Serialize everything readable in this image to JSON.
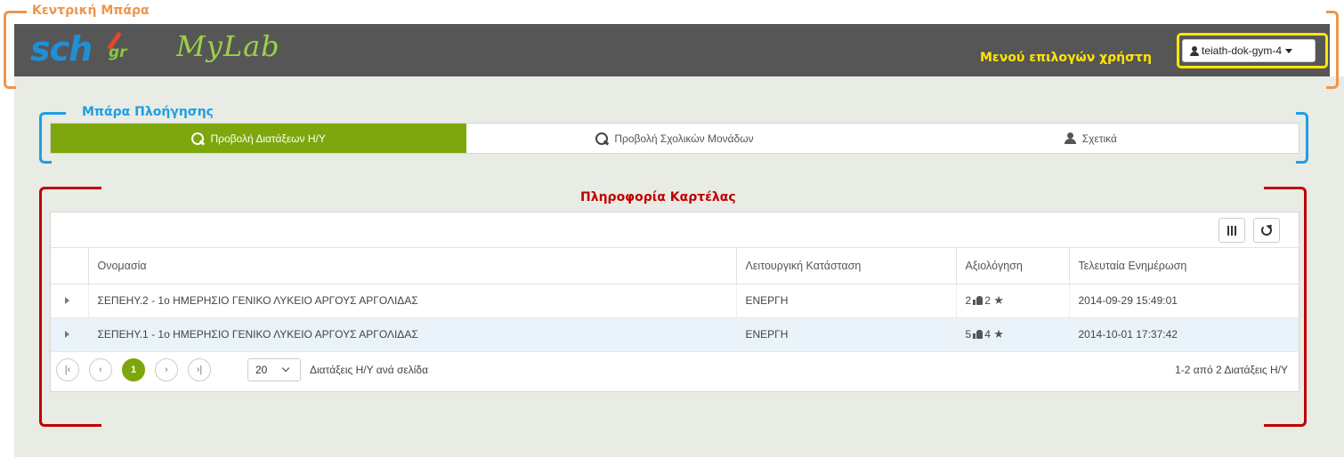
{
  "annotations": {
    "central_bar": "Κεντρική Μπάρα",
    "user_menu": "Μενού επιλογών χρήστη",
    "nav_bar": "Μπάρα Πλοήγησης",
    "tab_info": "Πληροφορία Καρτέλας"
  },
  "header": {
    "logo_sch": "sch",
    "logo_gr": "gr",
    "logo_mylab": "MyLab",
    "user_name": "teiath-dok-gym-4"
  },
  "nav": {
    "tabs": [
      {
        "label": "Προβολή Διατάξεων Η/Υ",
        "active": true,
        "icon": "search-icon"
      },
      {
        "label": "Προβολή Σχολικών Μονάδων",
        "active": false,
        "icon": "search-icon"
      },
      {
        "label": "Σχετικά",
        "active": false,
        "icon": "user-icon"
      }
    ]
  },
  "grid": {
    "columns": [
      "Ονομασία",
      "Λειτουργική Κατάσταση",
      "Αξιολόγηση",
      "Τελευταία Ενημέρωση"
    ],
    "rows": [
      {
        "name": "ΣΕΠΕΗΥ.2 - 1ο ΗΜΕΡΗΣΙΟ ΓΕΝΙΚΟ ΛΥΚΕΙΟ ΑΡΓΟΥΣ ΑΡΓΟΛΙΔΑΣ",
        "status": "ΕΝΕΡΓΗ",
        "likes": "2",
        "stars": "2",
        "updated": "2014-09-29 15:49:01"
      },
      {
        "name": "ΣΕΠΕΗΥ.1 - 1ο ΗΜΕΡΗΣΙΟ ΓΕΝΙΚΟ ΛΥΚΕΙΟ ΑΡΓΟΥΣ ΑΡΓΟΛΙΔΑΣ",
        "status": "ΕΝΕΡΓΗ",
        "likes": "5",
        "stars": "4",
        "updated": "2014-10-01 17:37:42"
      }
    ],
    "pager": {
      "current_page": "1",
      "page_size": "20",
      "per_page_label": "Διατάξεις Η/Υ ανά σελίδα",
      "range_label": "1-2 από 2 Διατάξεις Η/Υ"
    }
  },
  "colors": {
    "accent_green": "#7da70c",
    "annot_orange": "#f0954a",
    "annot_blue": "#1e9ee6",
    "annot_yellow": "#ffe600",
    "annot_red": "#c00000"
  }
}
